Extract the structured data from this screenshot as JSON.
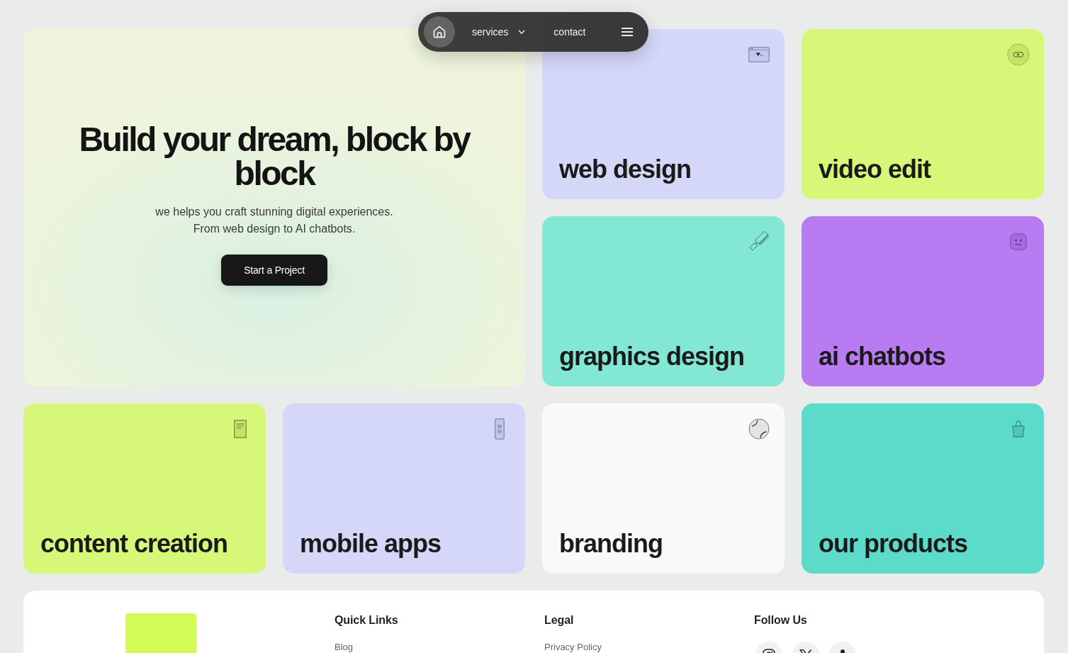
{
  "nav": {
    "links": [
      {
        "label": "services",
        "dropdown": true
      },
      {
        "label": "contact",
        "dropdown": false
      }
    ]
  },
  "hero": {
    "title": "Build your dream, block by block",
    "subtitle": "we helps you craft stunning digital experiences.\nFrom web design to AI chatbots.",
    "button": "Start a Project"
  },
  "cards": [
    {
      "title": "web design",
      "color": "#d4d7f8",
      "kind": "browser"
    },
    {
      "title": "video edit",
      "color": "#d6f777",
      "kind": "video"
    },
    {
      "title": "graphics design",
      "color": "#82e7d3",
      "kind": "brush"
    },
    {
      "title": "ai chatbots",
      "color": "#b87bf2",
      "kind": "bot"
    },
    {
      "title": "content creation",
      "color": "#d6f777",
      "kind": "document"
    },
    {
      "title": "mobile apps",
      "color": "#d4d7f8",
      "kind": "phone"
    },
    {
      "title": "branding",
      "color": "#f8faf9",
      "kind": "ball"
    },
    {
      "title": "our products",
      "color": "#5cdbca",
      "kind": "bag"
    }
  ],
  "footer": {
    "columns": [
      {
        "heading": "Quick Links",
        "links": [
          "Blog"
        ]
      },
      {
        "heading": "Legal",
        "links": [
          "Privacy Policy"
        ]
      },
      {
        "heading": "Follow Us",
        "socials": [
          {
            "kind": "camera"
          },
          {
            "kind": "x"
          },
          {
            "kind": "person"
          }
        ]
      }
    ]
  }
}
